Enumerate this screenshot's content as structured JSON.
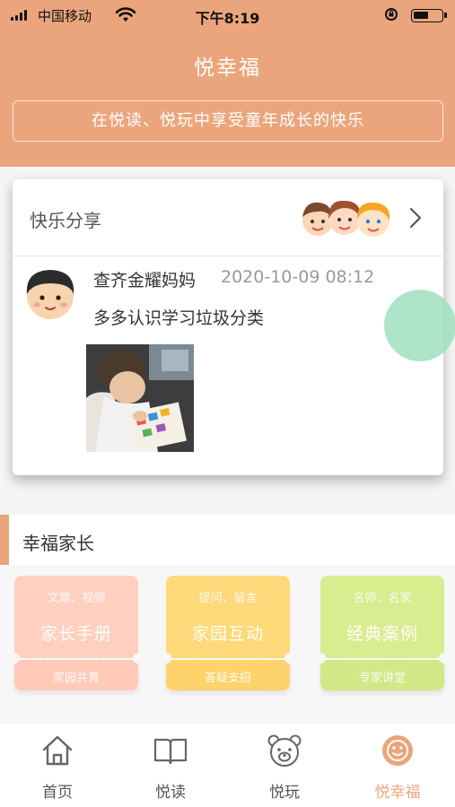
{
  "status_bar": {
    "carrier": "中国移动",
    "time": "下午8:19"
  },
  "header": {
    "title": "悦幸福",
    "slogan": "在悦读、悦玩中享受童年成长的快乐"
  },
  "share_card": {
    "title": "快乐分享",
    "post": {
      "author": "查齐金耀妈妈",
      "time": "2020-10-09 08:12",
      "content": "多多认识学习垃圾分类"
    }
  },
  "parents_section": {
    "title": "幸福家长",
    "tiles": [
      {
        "subtitle": "文章、视频",
        "title": "家长手册",
        "footer": "家园共育",
        "color": "#ffd0bf",
        "footer_color": "#ffcbb8"
      },
      {
        "subtitle": "提问、留言",
        "title": "家园互动",
        "footer": "答疑支招",
        "color": "#ffd97a",
        "footer_color": "#ffd36b"
      },
      {
        "subtitle": "名师、名家",
        "title": "经典案例",
        "footer": "专家讲堂",
        "color": "#d9ec8f",
        "footer_color": "#d2e887"
      }
    ]
  },
  "tab_bar": {
    "active_color": "#eba57c",
    "tabs": [
      {
        "label": "首页",
        "icon": "home-icon"
      },
      {
        "label": "悦读",
        "icon": "book-icon"
      },
      {
        "label": "悦玩",
        "icon": "bear-icon"
      },
      {
        "label": "悦幸福",
        "icon": "smile-icon",
        "active": true
      }
    ]
  }
}
